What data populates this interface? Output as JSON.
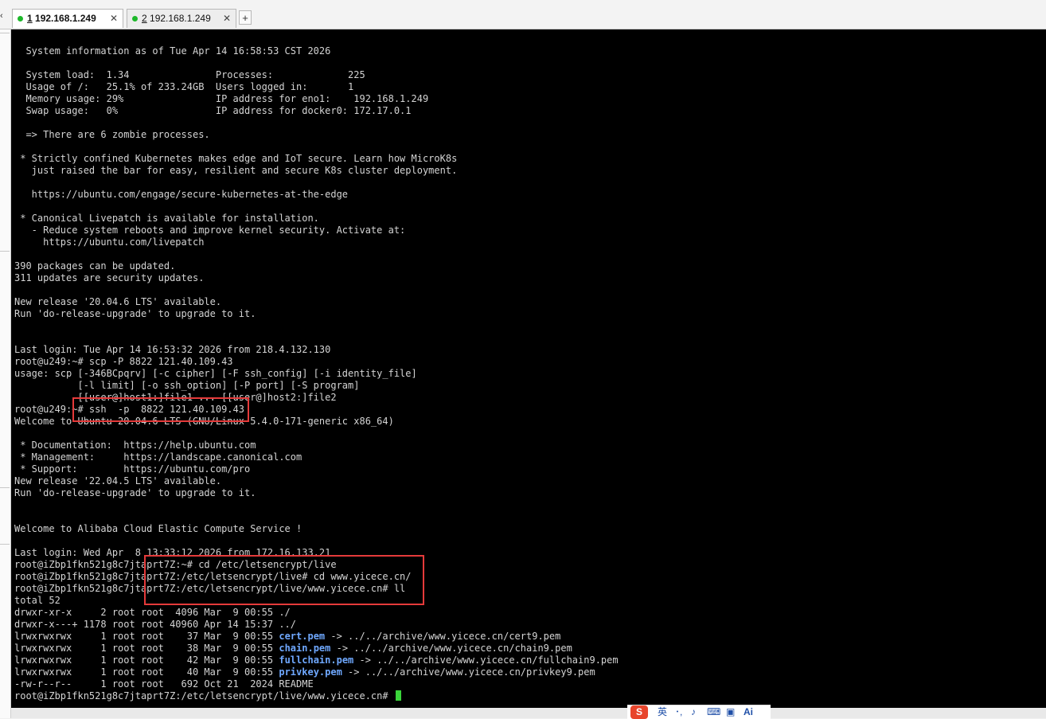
{
  "tabs": [
    {
      "number": "1",
      "label": " 192.168.1.249",
      "close": "✕"
    },
    {
      "number": "2",
      "label": " 192.168.1.249",
      "close": "✕"
    }
  ],
  "new_tab_label": "+",
  "colors": {
    "active_dot": "#1db82a",
    "highlight_box": "#e53a3a",
    "cursor": "#3ad53a",
    "link_file": "#6fa8ff"
  },
  "ime": {
    "logo": "S",
    "lang": "英",
    "icons": [
      "punctuation-icon",
      "microphone-icon",
      "keyboard-icon",
      "toolbox-icon",
      "ai-icon"
    ],
    "ai_label": "Ai"
  },
  "terminal": {
    "lines": [
      "  System information as of Tue Apr 14 16:58:53 CST 2026",
      "",
      "  System load:  1.34               Processes:             225",
      "  Usage of /:   25.1% of 233.24GB  Users logged in:       1",
      "  Memory usage: 29%                IP address for eno1:    192.168.1.249",
      "  Swap usage:   0%                 IP address for docker0: 172.17.0.1",
      "",
      "  => There are 6 zombie processes.",
      "",
      " * Strictly confined Kubernetes makes edge and IoT secure. Learn how MicroK8s",
      "   just raised the bar for easy, resilient and secure K8s cluster deployment.",
      "",
      "   https://ubuntu.com/engage/secure-kubernetes-at-the-edge",
      "",
      " * Canonical Livepatch is available for installation.",
      "   - Reduce system reboots and improve kernel security. Activate at:",
      "     https://ubuntu.com/livepatch",
      "",
      "390 packages can be updated.",
      "311 updates are security updates.",
      "",
      "New release '20.04.6 LTS' available.",
      "Run 'do-release-upgrade' to upgrade to it.",
      "",
      "",
      "Last login: Tue Apr 14 16:53:32 2026 from 218.4.132.130",
      "root@u249:~# scp -P 8822 121.40.109.43",
      "usage: scp [-346BCpqrv] [-c cipher] [-F ssh_config] [-i identity_file]",
      "           [-l limit] [-o ssh_option] [-P port] [-S program]",
      "           [[user@]host1:]file1 ... [[user@]host2:]file2",
      "root@u249:~# ssh  -p  8822 121.40.109.43",
      "Welcome to Ubuntu 20.04.6 LTS (GNU/Linux 5.4.0-171-generic x86_64)",
      "",
      " * Documentation:  https://help.ubuntu.com",
      " * Management:     https://landscape.canonical.com",
      " * Support:        https://ubuntu.com/pro",
      "New release '22.04.5 LTS' available.",
      "Run 'do-release-upgrade' to upgrade to it.",
      "",
      "",
      "Welcome to Alibaba Cloud Elastic Compute Service !",
      "",
      "Last login: Wed Apr  8 13:33:12 2026 from 172.16.133.21",
      "root@iZbp1fkn521g8c7jtaprt7Z:~# cd /etc/letsencrypt/live",
      "root@iZbp1fkn521g8c7jtaprt7Z:/etc/letsencrypt/live# cd www.yicece.cn/",
      "root@iZbp1fkn521g8c7jtaprt7Z:/etc/letsencrypt/live/www.yicece.cn# ll",
      "total 52",
      "drwxr-xr-x     2 root root  4096 Mar  9 00:55 ./",
      "drwxr-x---+ 1178 root root 40960 Apr 14 15:37 ../"
    ],
    "listing": [
      {
        "prefix": "lrwxrwxrwx     1 root root    37 Mar  9 00:55 ",
        "name": "cert.pem",
        "target": " -> ../../archive/www.yicece.cn/cert9.pem"
      },
      {
        "prefix": "lrwxrwxrwx     1 root root    38 Mar  9 00:55 ",
        "name": "chain.pem",
        "target": " -> ../../archive/www.yicece.cn/chain9.pem"
      },
      {
        "prefix": "lrwxrwxrwx     1 root root    42 Mar  9 00:55 ",
        "name": "fullchain.pem",
        "target": " -> ../../archive/www.yicece.cn/fullchain9.pem"
      },
      {
        "prefix": "lrwxrwxrwx     1 root root    40 Mar  9 00:55 ",
        "name": "privkey.pem",
        "target": " -> ../../archive/www.yicece.cn/privkey9.pem"
      }
    ],
    "after_listing": [
      "-rw-r--r--     1 root root   692 Oct 21  2024 README"
    ],
    "prompt": "root@iZbp1fkn521g8c7jtaprt7Z:/etc/letsencrypt/live/www.yicece.cn# "
  }
}
